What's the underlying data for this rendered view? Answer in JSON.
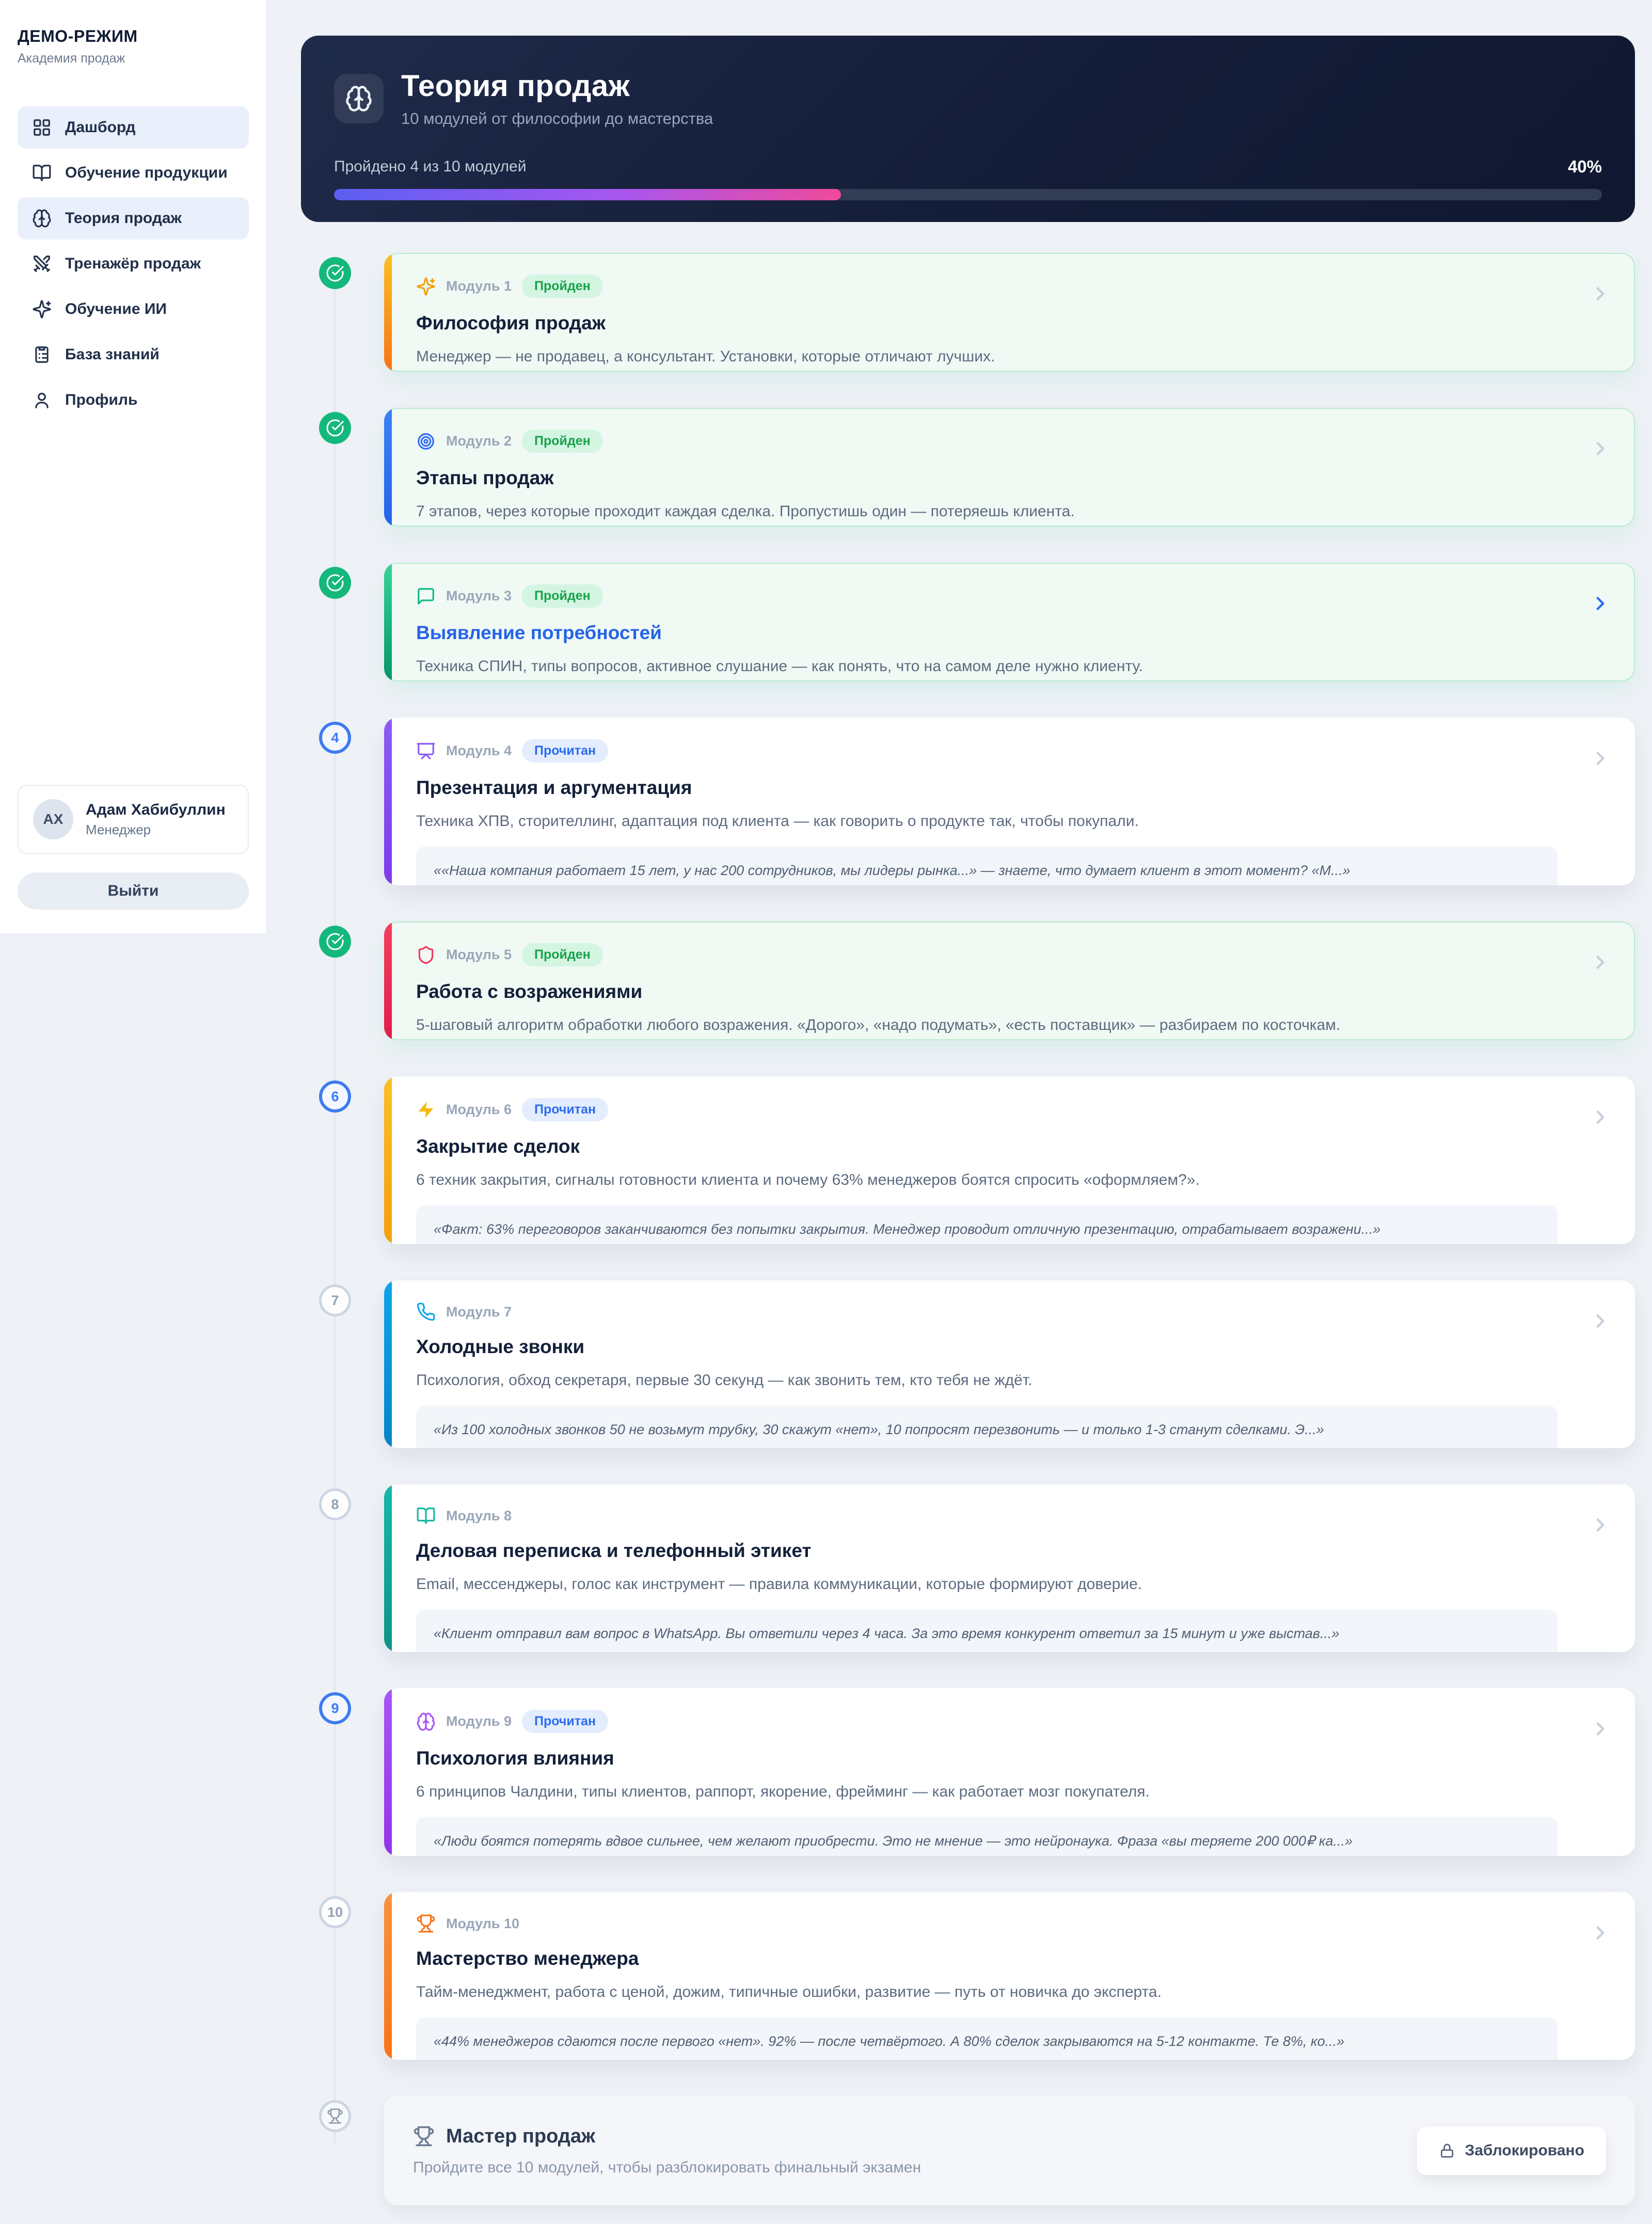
{
  "sidebar": {
    "title": "ДЕМО-РЕЖИМ",
    "subtitle": "Академия продаж",
    "nav": [
      {
        "label": "Дашборд",
        "icon": "grid-icon",
        "active": true
      },
      {
        "label": "Обучение продукции",
        "icon": "book-open-icon",
        "active": false
      },
      {
        "label": "Теория продаж",
        "icon": "brain-icon",
        "active": true
      },
      {
        "label": "Тренажёр продаж",
        "icon": "swords-icon",
        "active": false
      },
      {
        "label": "Обучение ИИ",
        "icon": "sparkles-icon",
        "active": false
      },
      {
        "label": "База знаний",
        "icon": "clipboard-icon",
        "active": false
      },
      {
        "label": "Профиль",
        "icon": "user-icon",
        "active": false
      }
    ],
    "user": {
      "initials": "АХ",
      "name": "Адам Хабибуллин",
      "role": "Менеджер"
    },
    "logout_label": "Выйти"
  },
  "header": {
    "title": "Теория продаж",
    "subtitle": "10 модулей от философии до мастерства",
    "progress_label": "Пройдено 4 из 10 модулей",
    "progress_percent_label": "40%",
    "progress_value": 40,
    "accent_gradient": [
      "#5b5ff1",
      "#a557f0",
      "#ef4a9b"
    ]
  },
  "modules": [
    {
      "num_label": "Модуль 1",
      "icon": "sparkles-icon",
      "icon_color": "#f59e0b",
      "accent": [
        "#fbbf24",
        "#f97316"
      ],
      "badge": "Пройден",
      "state": "done",
      "node": "check",
      "title": "Философия продаж",
      "desc": "Менеджер — не продавец, а консультант. Установки, которые отличают лучших.",
      "quote": null
    },
    {
      "num_label": "Модуль 2",
      "icon": "target-icon",
      "icon_color": "#2e6bf0",
      "accent": [
        "#3b82f6",
        "#2563eb"
      ],
      "badge": "Пройден",
      "state": "done",
      "node": "check",
      "title": "Этапы продаж",
      "desc": "7 этапов, через которые проходит каждая сделка. Пропустишь один — потеряешь клиента.",
      "quote": null
    },
    {
      "num_label": "Модуль 3",
      "icon": "chat-icon",
      "icon_color": "#10b981",
      "accent": [
        "#34d399",
        "#059669"
      ],
      "badge": "Пройден",
      "state": "done",
      "node": "check",
      "highlight": true,
      "title": "Выявление потребностей",
      "desc": "Техника СПИН, типы вопросов, активное слушание — как понять, что на самом деле нужно клиенту.",
      "quote": null
    },
    {
      "num_label": "Модуль 4",
      "icon": "presentation-icon",
      "icon_color": "#8b5cf6",
      "accent": [
        "#8b5cf6",
        "#7c3aed"
      ],
      "badge": "Прочитан",
      "state": "read",
      "node": "4",
      "title": "Презентация и аргументация",
      "desc": "Техника ХПВ, сторителлинг, адаптация под клиента — как говорить о продукте так, чтобы покупали.",
      "quote": "««Наша компания работает 15 лет, у нас 200 сотрудников, мы лидеры рынка...» — знаете, что думает клиент в этот момент? «М...»"
    },
    {
      "num_label": "Модуль 5",
      "icon": "shield-icon",
      "icon_color": "#ef3a5d",
      "accent": [
        "#f43f5e",
        "#e11d48"
      ],
      "badge": "Пройден",
      "state": "done",
      "node": "check",
      "title": "Работа с возражениями",
      "desc": "5-шаговый алгоритм обработки любого возражения. «Дорого», «надо подумать», «есть поставщик» — разбираем по косточкам.",
      "quote": null
    },
    {
      "num_label": "Модуль 6",
      "icon": "bolt-icon",
      "icon_color": "#f4b90c",
      "accent": [
        "#fbbf24",
        "#f59e0b"
      ],
      "badge": "Прочитан",
      "state": "read",
      "node": "6",
      "title": "Закрытие сделок",
      "desc": "6 техник закрытия, сигналы готовности клиента и почему 63% менеджеров боятся спросить «оформляем?».",
      "quote": "«Факт: 63% переговоров заканчиваются без попытки закрытия. Менеджер проводит отличную презентацию, отрабатывает возражени...»"
    },
    {
      "num_label": "Модуль 7",
      "icon": "phone-icon",
      "icon_color": "#0ea5e9",
      "accent": [
        "#0ea5e9",
        "#0284c7"
      ],
      "badge": null,
      "state": "upcoming",
      "node": "7",
      "title": "Холодные звонки",
      "desc": "Психология, обход секретаря, первые 30 секунд — как звонить тем, кто тебя не ждёт.",
      "quote": "«Из 100 холодных звонков 50 не возьмут трубку, 30 скажут «нет», 10 попросят перезвонить — и только 1-3 станут сделками. Э...»"
    },
    {
      "num_label": "Модуль 8",
      "icon": "book-open-icon",
      "icon_color": "#14b8a6",
      "accent": [
        "#14b8a6",
        "#0d9488"
      ],
      "badge": null,
      "state": "upcoming",
      "node": "8",
      "title": "Деловая переписка и телефонный этикет",
      "desc": "Email, мессенджеры, голос как инструмент — правила коммуникации, которые формируют доверие.",
      "quote": "«Клиент отправил вам вопрос в WhatsApp. Вы ответили через 4 часа. За это время конкурент ответил за 15 минут и уже выстав...»"
    },
    {
      "num_label": "Модуль 9",
      "icon": "brain-icon",
      "icon_color": "#a855f7",
      "accent": [
        "#a855f7",
        "#9333ea"
      ],
      "badge": "Прочитан",
      "state": "read",
      "node": "9",
      "title": "Психология влияния",
      "desc": "6 принципов Чалдини, типы клиентов, раппорт, якорение, фрейминг — как работает мозг покупателя.",
      "quote": "«Люди боятся потерять вдвое сильнее, чем желают приобрести. Это не мнение — это нейронаука. Фраза «вы теряете 200 000₽ ка...»"
    },
    {
      "num_label": "Модуль 10",
      "icon": "trophy-icon",
      "icon_color": "#f97316",
      "accent": [
        "#fb923c",
        "#f97316"
      ],
      "badge": null,
      "state": "upcoming",
      "node": "10",
      "title": "Мастерство менеджера",
      "desc": "Тайм-менеджмент, работа с ценой, дожим, типичные ошибки, развитие — путь от новичка до эксперта.",
      "quote": "«44% менеджеров сдаются после первого «нет». 92% — после четвёртого. А 80% сделок закрываются на 5-12 контакте. Те 8%, ко...»"
    }
  ],
  "final": {
    "title": "Мастер продаж",
    "desc": "Пройдите все 10 модулей, чтобы разблокировать финальный экзамен",
    "button_label": "Заблокировано"
  }
}
